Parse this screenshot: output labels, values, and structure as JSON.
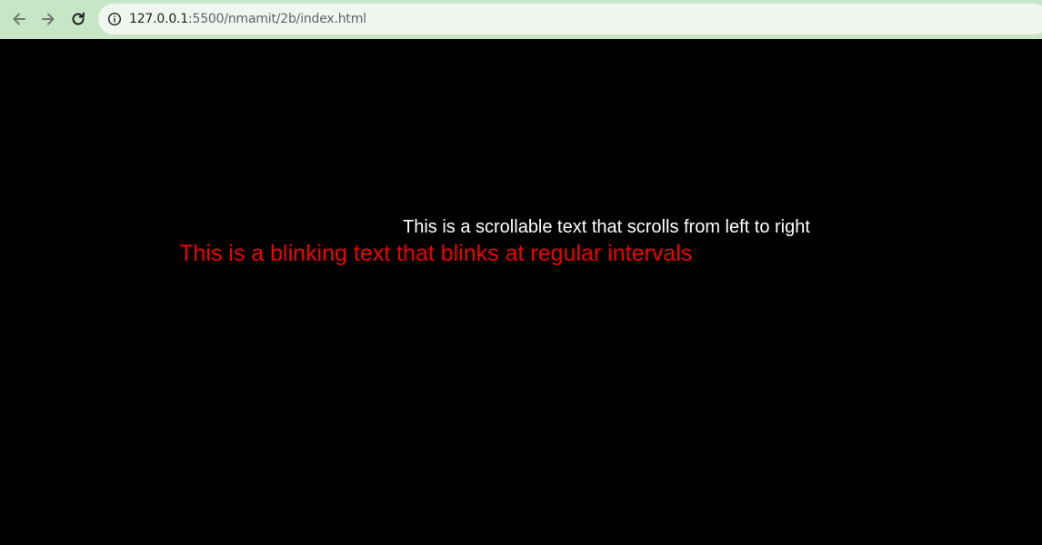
{
  "browser": {
    "url_host": "127.0.0.1",
    "url_rest": ":5500/nmamit/2b/index.html",
    "icons": {
      "back": "back-arrow-icon",
      "forward": "forward-arrow-icon",
      "reload": "reload-icon",
      "site_info": "info-icon"
    },
    "toolbar_color": "#c7e6c6",
    "omnibox_color": "#f1f6f0"
  },
  "page": {
    "scroll_text": "This is a scrollable text that scrolls from left to right",
    "blink_text": "This is a blinking text that blinks at regular intervals",
    "background_color": "#000000",
    "scroll_text_color": "#ffffff",
    "blink_text_color": "#ee0000"
  }
}
